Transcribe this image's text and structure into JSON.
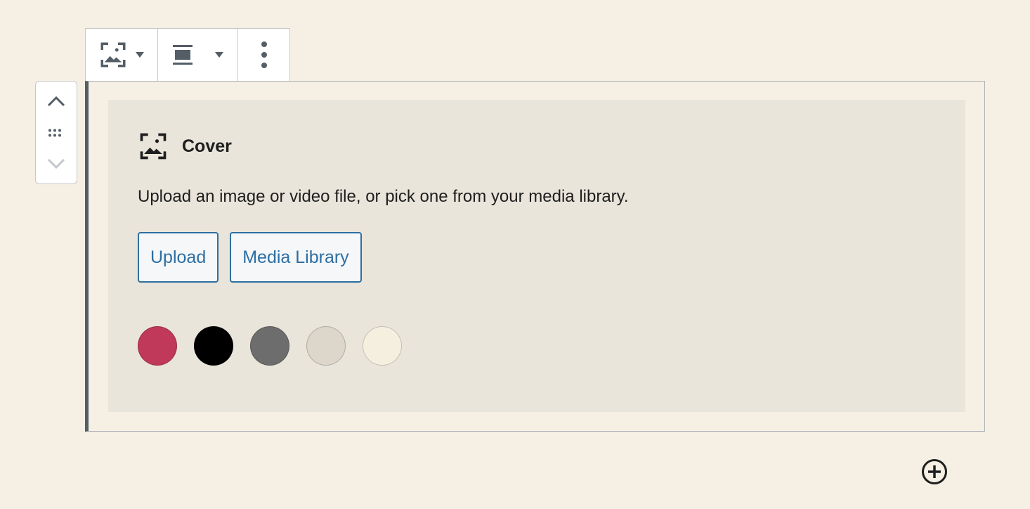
{
  "toolbar": {
    "block_type_icon": "cover-icon",
    "align_icon": "align-wide-icon",
    "more_icon": "more-vertical-icon"
  },
  "movers": {
    "up_icon": "chevron-up-icon",
    "drag_icon": "drag-handle-icon",
    "down_icon": "chevron-down-icon"
  },
  "placeholder": {
    "title": "Cover",
    "instructions": "Upload an image or video file, or pick one from your media library.",
    "upload_label": "Upload",
    "media_library_label": "Media Library",
    "colors": [
      "#c0385a",
      "#000000",
      "#6d6d6d",
      "#dcd7ca",
      "#f5efe0"
    ]
  },
  "inserter": {
    "icon": "plus-circle-icon"
  }
}
